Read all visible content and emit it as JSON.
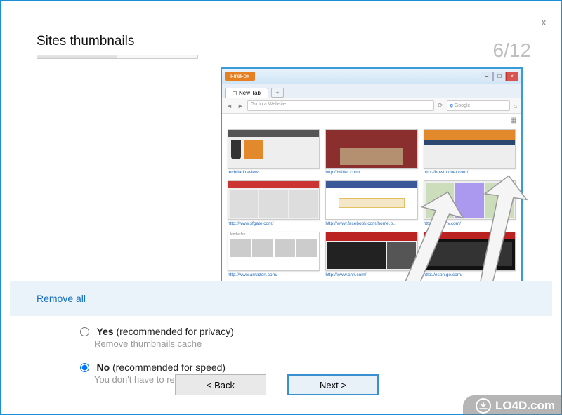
{
  "window": {
    "minimize": "_",
    "close": "x"
  },
  "wizard": {
    "title": "Sites thumbnails",
    "step_current": 6,
    "step_total": 12,
    "step_display": "6/12",
    "section_link": "Remove all",
    "back_label": "< Back",
    "next_label": "Next >"
  },
  "options": {
    "yes": {
      "label_bold": "Yes",
      "label_rest": " (recommended for privacy)",
      "sub": "Remove thumbnails cache",
      "selected": false
    },
    "no": {
      "label_bold": "No",
      "label_rest": " (recommended for speed)",
      "sub": "You don't have to retype everything",
      "selected": true
    }
  },
  "illustration": {
    "browser_button": "FireFox",
    "tab_label": "New Tab",
    "newtab_plus": "+",
    "url_placeholder": "Go to a Website",
    "search_placeholder": "Google",
    "thumbnails": [
      {
        "label": "techdad review"
      },
      {
        "label": "http://twitter.com/"
      },
      {
        "label": "http://howto.cnet.com/"
      },
      {
        "label": "http://www.sfgate.com/"
      },
      {
        "label": "http://www.facebook.com/home.p..."
      },
      {
        "label": "http://xfinitytv.com/"
      },
      {
        "label": "http://www.amazon.com/"
      },
      {
        "label": "http://www.cnn.com/"
      },
      {
        "label": "http://espn.go.com/"
      }
    ]
  },
  "watermark": {
    "text": "LO4D.com"
  }
}
